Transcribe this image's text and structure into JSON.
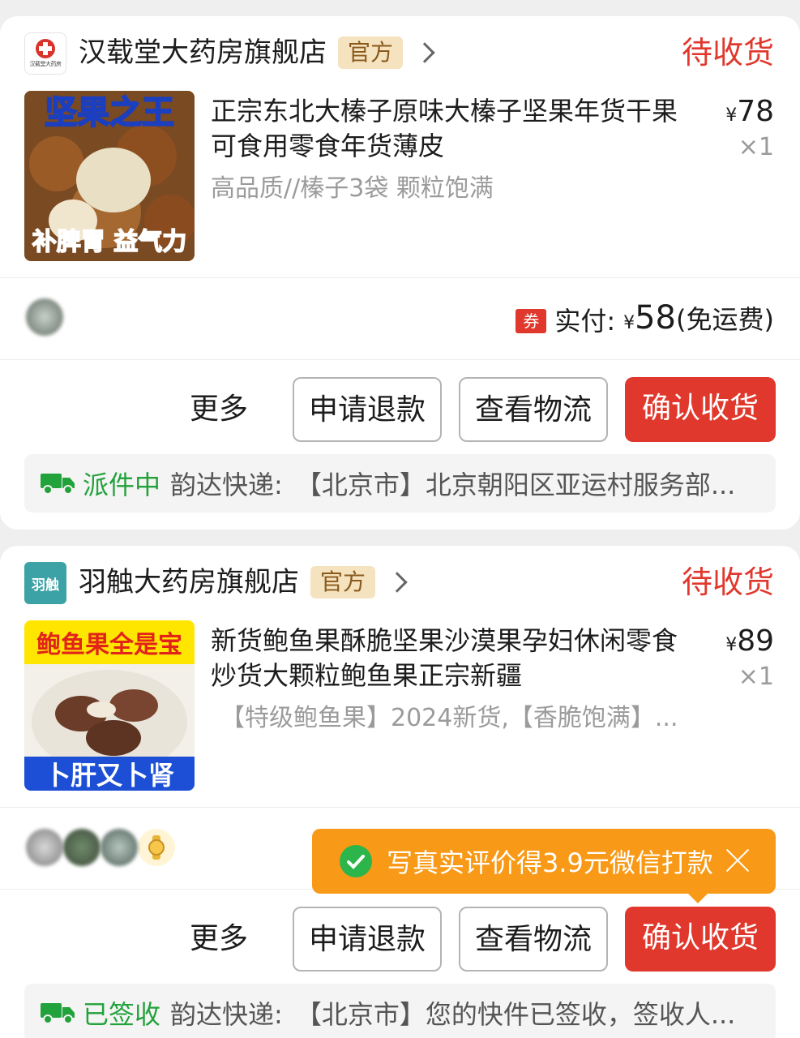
{
  "orders": [
    {
      "shop_name": "汉载堂大药房旗舰店",
      "shop_logo_text": "汉载堂大药房",
      "official_badge": "官方",
      "status": "待收货",
      "product_title": "正宗东北大榛子原味大榛子坚果年货干果可食用零食年货薄皮",
      "product_spec": "高品质//榛子3袋 颗粒饱满",
      "thumb_top_text": "坚果之王",
      "thumb_bottom_text": "补脾胃 益气力",
      "currency": "¥",
      "price": "78",
      "quantity": "×1",
      "coupon_badge": "券",
      "paid_label": "实付:",
      "paid_amount": "58",
      "shipping_note": "(免运费)",
      "btn_more": "更多",
      "btn_refund": "申请退款",
      "btn_logistics": "查看物流",
      "btn_confirm": "确认收货",
      "logistics_status": "派件中",
      "courier": "韵达快递:",
      "logistics_detail": "【北京市】北京朝阳区亚运村服务部..."
    },
    {
      "shop_name": "羽触大药房旗舰店",
      "shop_logo_text": "羽触",
      "official_badge": "官方",
      "status": "待收货",
      "product_title": "新货鲍鱼果酥脆坚果沙漠果孕妇休闲零食炒货大颗粒鲍鱼果正宗新疆",
      "product_spec": "【特级鲍鱼果】2024新货,【香脆饱满】...",
      "thumb_top_text": "鲍鱼果全是宝",
      "thumb_bottom_text": "卜肝又卜肾",
      "currency": "¥",
      "price": "89",
      "quantity": "×1",
      "tooltip_text": "写真实评价得3.9元微信打款",
      "btn_more": "更多",
      "btn_refund": "申请退款",
      "btn_logistics": "查看物流",
      "btn_confirm": "确认收货",
      "logistics_status": "已签收",
      "courier": "韵达快递:",
      "logistics_detail": "【北京市】您的快件已签收，签收人..."
    }
  ],
  "colors": {
    "accent_red": "#e0382d",
    "delivery_green": "#22a23b",
    "tooltip_orange": "#f89a17",
    "badge_bg": "#f5e3c0"
  }
}
